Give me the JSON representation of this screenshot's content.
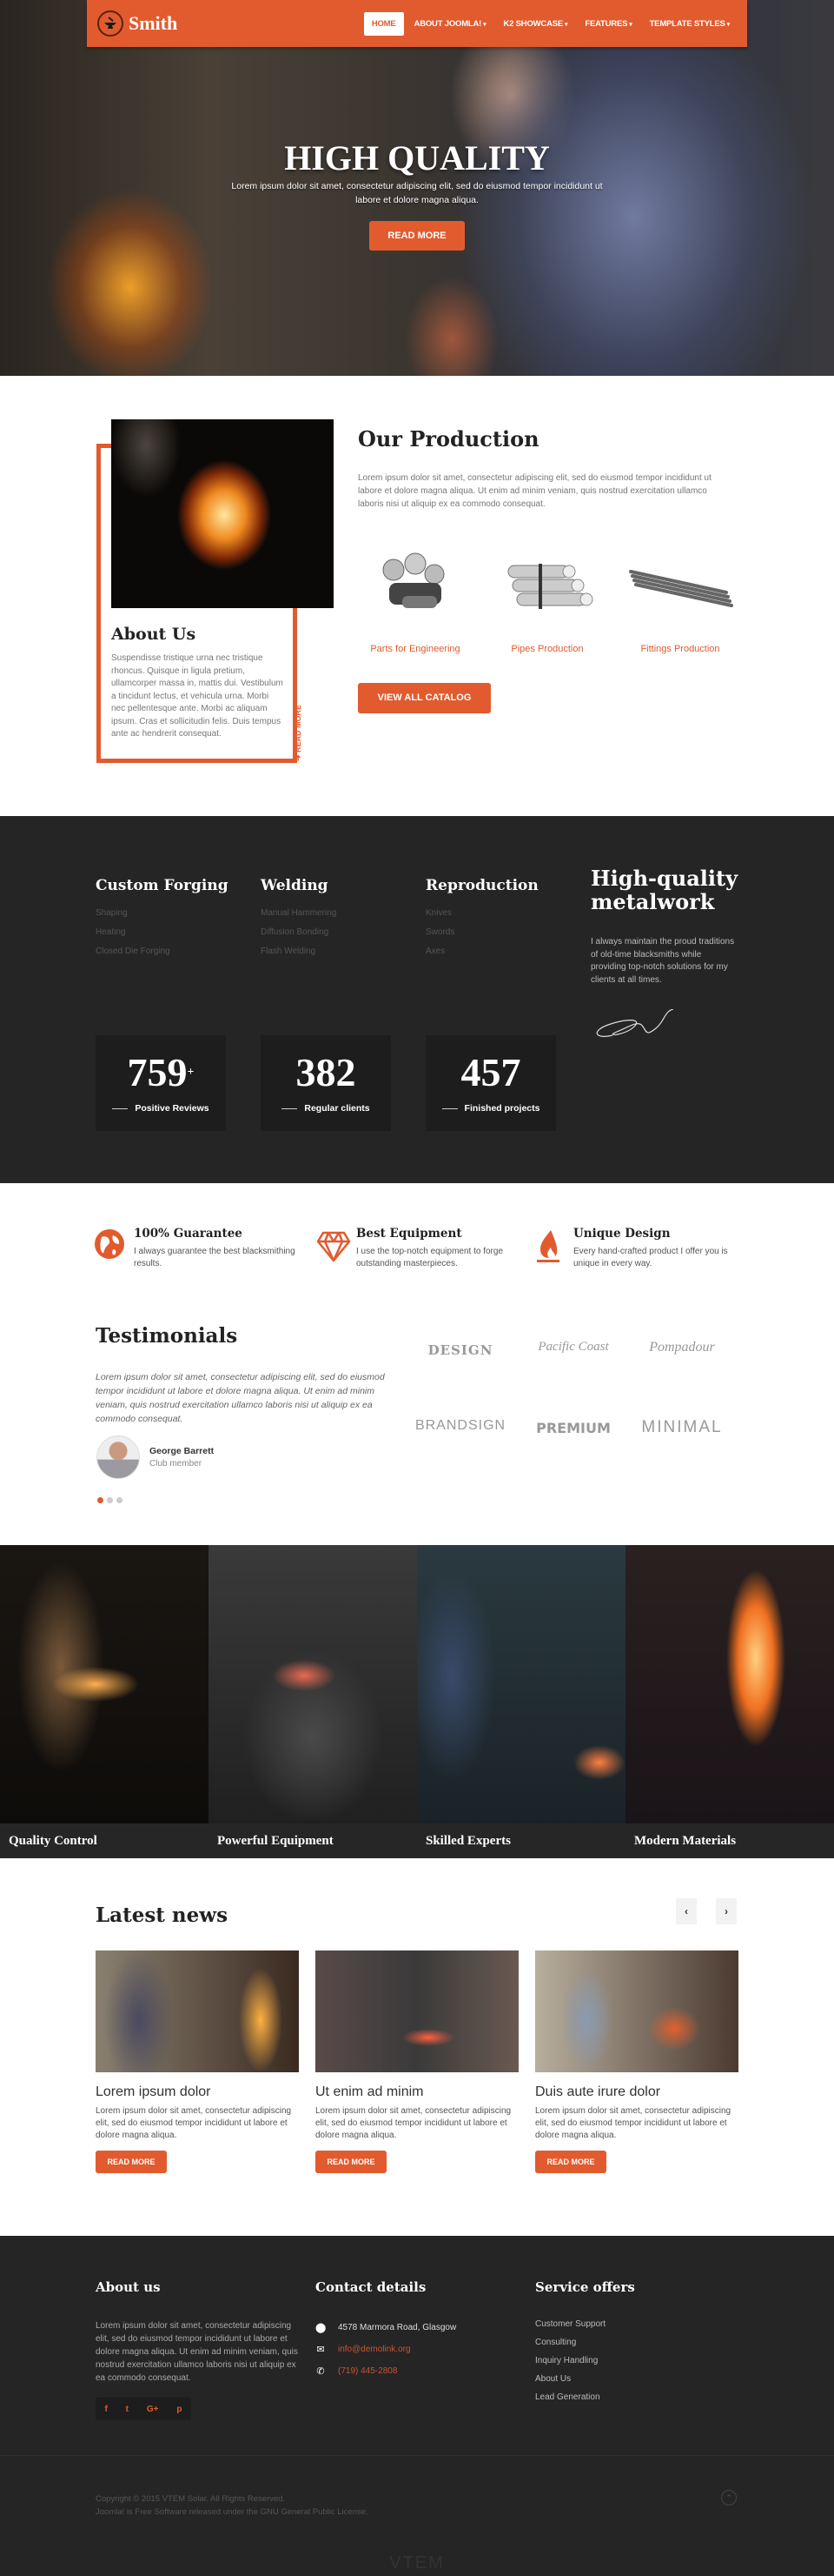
{
  "header": {
    "logo_text": "Smith",
    "nav": [
      {
        "label": "HOME",
        "active": true,
        "dropdown": false
      },
      {
        "label": "ABOUT JOOMLA!",
        "active": false,
        "dropdown": true
      },
      {
        "label": "K2 SHOWCASE",
        "active": false,
        "dropdown": true
      },
      {
        "label": "FEATURES",
        "active": false,
        "dropdown": true
      },
      {
        "label": "TEMPLATE STYLES",
        "active": false,
        "dropdown": true
      }
    ],
    "caret": "▾"
  },
  "hero": {
    "title": "HIGH QUALITY",
    "subtitle": "Lorem ipsum dolor sit amet, consectetur adipiscing elit, sed do eiusmod tempor incididunt ut labore et dolore magna aliqua.",
    "button": "READ MORE"
  },
  "about": {
    "title": "About Us",
    "text": "Suspendisse tristique urna nec tristique rhoncus. Quisque in ligula pretium, ullamcorper massa in, mattis dui. Vestibulum a tincidunt lectus, et vehicula urna. Morbi nec pellentesque ante. Morbi ac aliquam ipsum. Cras et sollicitudin felis. Duis tempus ante ac hendrerit consequat.",
    "read_more": "➜ READ MORE"
  },
  "production": {
    "title": "Our Production",
    "text": "Lorem ipsum dolor sit amet, consectetur adipiscing elit, sed do eiusmod tempor incididunt ut labore et dolore magna aliqua. Ut enim ad minim veniam, quis nostrud exercitation ullamco laboris nisi ut aliquip ex ea commodo consequat.",
    "items": [
      {
        "label": "Parts for Engineering"
      },
      {
        "label": "Pipes Production"
      },
      {
        "label": "Fittings Production"
      }
    ],
    "button": "VIEW ALL CATALOG"
  },
  "services": [
    {
      "title": "Custom Forging",
      "items": [
        "Shaping",
        "Heating",
        "Closed Die Forging"
      ]
    },
    {
      "title": "Welding",
      "items": [
        "Manual Hammering",
        "Diffusion Bonding",
        "Flash Welding"
      ]
    },
    {
      "title": "Reproduction",
      "items": [
        "Knives",
        "Swords",
        "Axes"
      ]
    }
  ],
  "metalwork": {
    "title_line1": "High-quality",
    "title_line2": "metalwork",
    "text": "I always maintain the proud traditions of old-time blacksmiths while providing top-notch solutions for my clients at all times."
  },
  "stats": [
    {
      "value": "759",
      "suffix": "+",
      "label": "Positive Reviews"
    },
    {
      "value": "382",
      "suffix": "",
      "label": "Regular clients"
    },
    {
      "value": "457",
      "suffix": "",
      "label": "Finished projects"
    }
  ],
  "features": [
    {
      "icon": "globe-icon",
      "title": "100% Guarantee",
      "text": "I always guarantee the best blacksmithing results."
    },
    {
      "icon": "diamond-icon",
      "title": "Best Equipment",
      "text": "I use the top-notch equipment to forge outstanding masterpieces."
    },
    {
      "icon": "flame-icon",
      "title": "Unique Design",
      "text": "Every hand-crafted product I offer you is unique in every way."
    }
  ],
  "testimonials": {
    "title": "Testimonials",
    "quote": "Lorem ipsum dolor sit amet, consectetur adipiscing elit, sed do eiusmod tempor incididunt ut labore et dolore magna aliqua. Ut enim ad minim veniam, quis nostrud exercitation ullamco laboris nisi ut aliquip ex ea commodo consequat.",
    "name": "George Barrett",
    "role": "Club member",
    "active_slide": 1,
    "slide_count": 3
  },
  "brands": [
    "DESIGN",
    "Pacific Coast",
    "Pompadour",
    "BRANDSIGN",
    "PREMIUM",
    "MINIMAL"
  ],
  "gallery": [
    {
      "caption": "Quality Control"
    },
    {
      "caption": "Powerful Equipment"
    },
    {
      "caption": "Skilled Experts"
    },
    {
      "caption": "Modern Materials"
    }
  ],
  "news": {
    "title": "Latest news",
    "prev": "‹",
    "next": "›",
    "items": [
      {
        "title": "Lorem ipsum dolor",
        "text": "Lorem ipsum dolor sit amet, consectetur adipiscing elit, sed do eiusmod tempor incididunt ut labore et dolore magna aliqua.",
        "button": "READ MORE"
      },
      {
        "title": "Ut enim ad minim",
        "text": "Lorem ipsum dolor sit amet, consectetur adipiscing elit, sed do eiusmod tempor incididunt ut labore et dolore magna aliqua.",
        "button": "READ MORE"
      },
      {
        "title": "Duis aute irure dolor",
        "text": "Lorem ipsum dolor sit amet, consectetur adipiscing elit, sed do eiusmod tempor incididunt ut labore et dolore magna aliqua.",
        "button": "READ MORE"
      }
    ]
  },
  "footer": {
    "about_title": "About us",
    "about_text": "Lorem ipsum dolor sit amet, consectetur adipiscing elit, sed do eiusmod tempor incididunt ut labore et dolore magna aliqua. Ut enim ad minim veniam, quis nostrud exercitation ullamco laboris nisi ut aliquip ex ea commodo consequat.",
    "social": [
      "f",
      "t",
      "G+",
      "p"
    ],
    "contact_title": "Contact details",
    "address": "4578 Marmora Road, Glasgow",
    "email": "info@demolink.org",
    "phone": "(719) 445-2808",
    "services_title": "Service offers",
    "services": [
      "Customer Support",
      "Consulting",
      "Inquiry Handling",
      "About Us",
      "Lead Generation"
    ],
    "copyright": "Copyright © 2015 VTEM Solar. All Rights Reserved.",
    "license": "Joomla! is Free Software released under the GNU General Public License.",
    "brand": "VTEM"
  },
  "colors": {
    "accent": "#e15b2f",
    "dark": "#252525"
  }
}
